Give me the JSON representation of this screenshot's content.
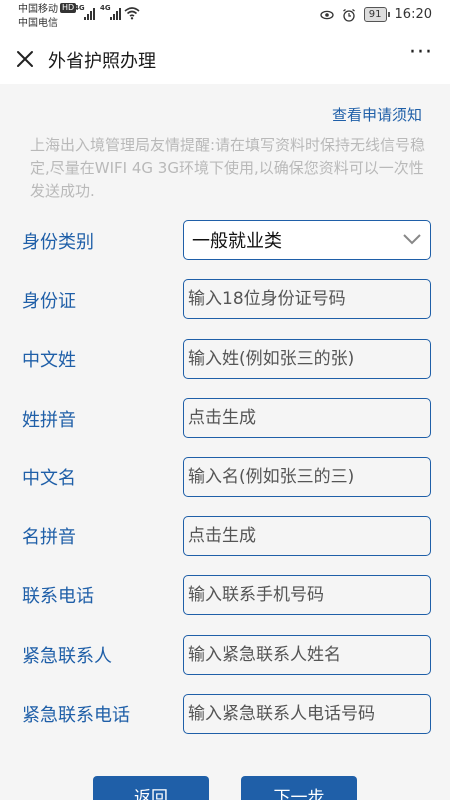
{
  "status_bar": {
    "carrier1": "中国移动",
    "carrier2": "中国电信",
    "hd": "HD",
    "net1": "4G",
    "net2": "4G",
    "battery": "91",
    "time": "16:20"
  },
  "title_bar": {
    "title": "外省护照办理"
  },
  "notice_link": "查看申请须知",
  "hint": "上海出入境管理局友情提醒:请在填写资料时保持无线信号稳定,尽量在WIFI 4G 3G环境下使用,以确保您资料可以一次性发送成功.",
  "form": {
    "identity_type": {
      "label": "身份类别",
      "value": "一般就业类"
    },
    "id_card": {
      "label": "身份证",
      "placeholder": "输入18位身份证号码"
    },
    "surname": {
      "label": "中文姓",
      "placeholder": "输入姓(例如张三的张)"
    },
    "surname_pinyin": {
      "label": "姓拼音",
      "placeholder": "点击生成"
    },
    "given_name": {
      "label": "中文名",
      "placeholder": "输入名(例如张三的三)"
    },
    "given_pinyin": {
      "label": "名拼音",
      "placeholder": "点击生成"
    },
    "phone": {
      "label": "联系电话",
      "placeholder": "输入联系手机号码"
    },
    "emergency_contact": {
      "label": "紧急联系人",
      "placeholder": "输入紧急联系人姓名"
    },
    "emergency_phone": {
      "label": "紧急联系电话",
      "placeholder": "输入紧急联系人电话号码"
    }
  },
  "buttons": {
    "back": "返回",
    "next": "下一步"
  },
  "colors": {
    "accent": "#1f5fa8",
    "hint": "#b9b9b9"
  }
}
